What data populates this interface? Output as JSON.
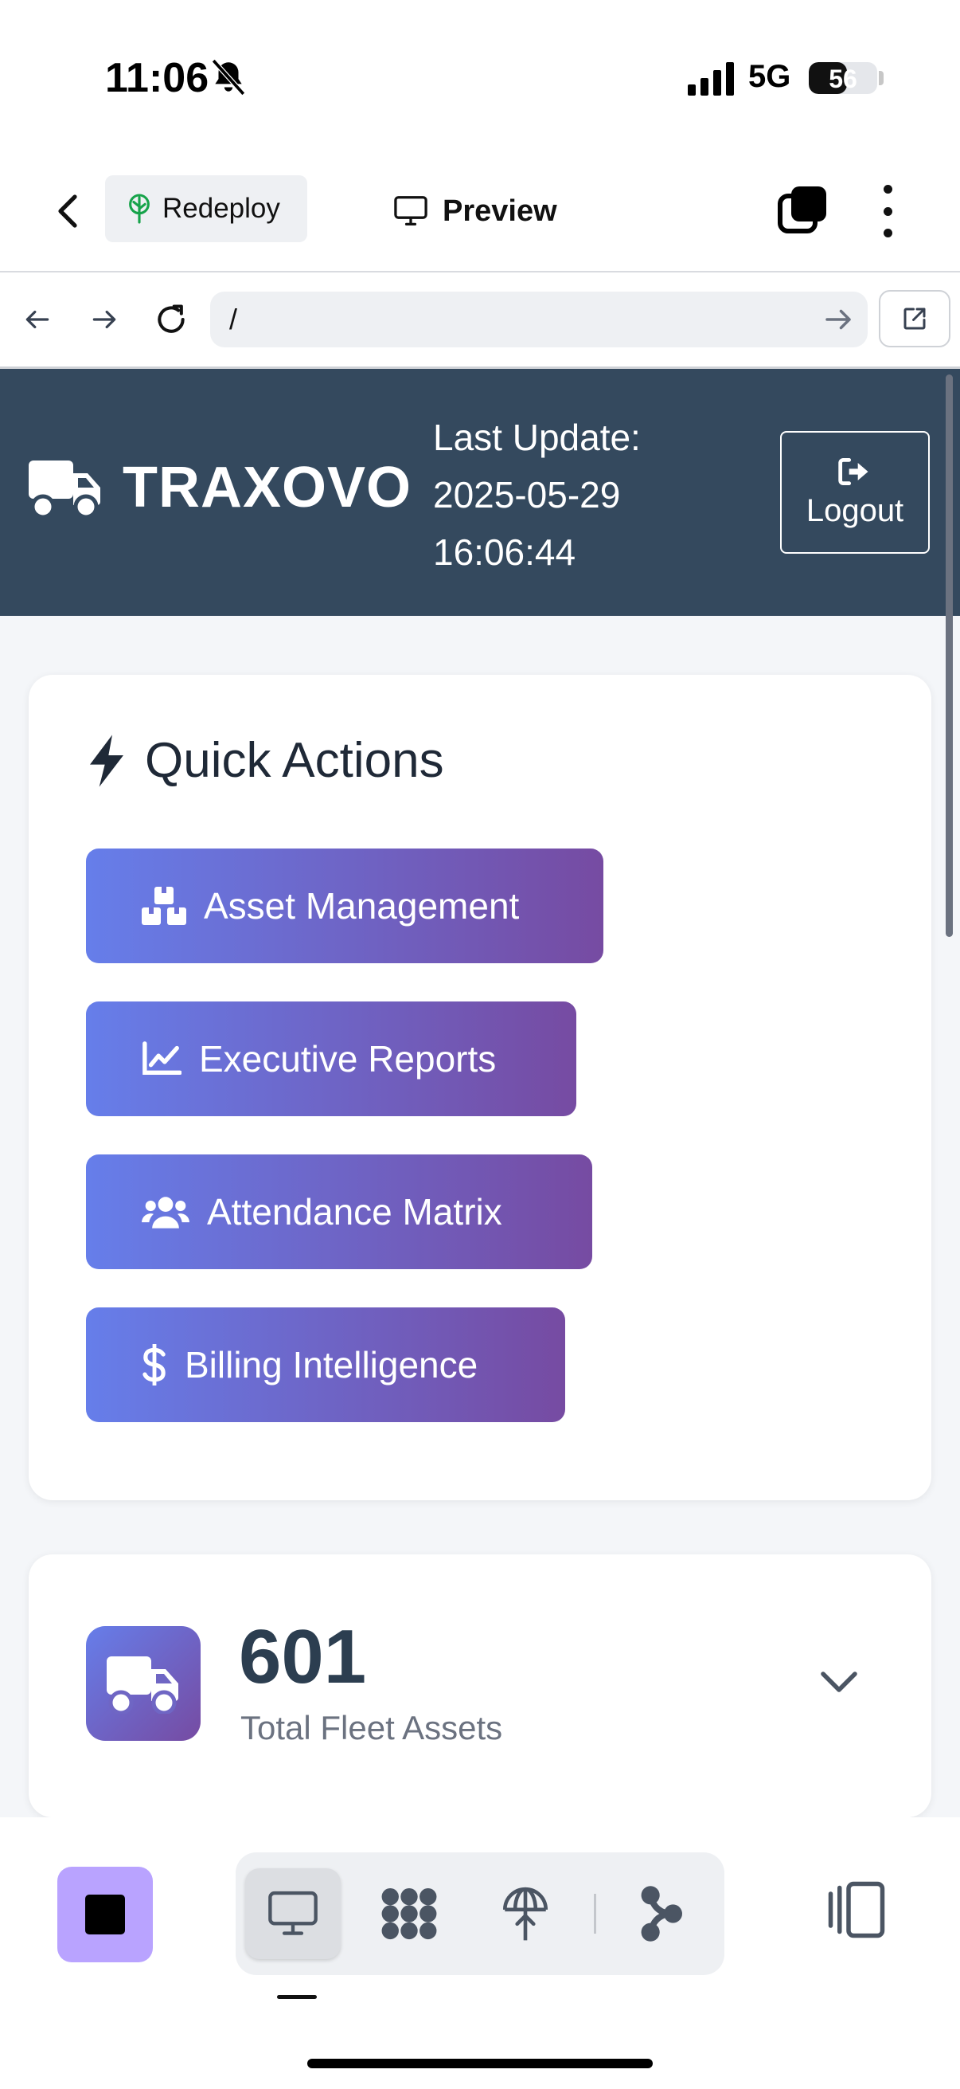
{
  "status_bar": {
    "time": "11:06",
    "network": "5G",
    "battery": "56",
    "battery_level": 0.56
  },
  "toolbar": {
    "redeploy_label": "Redeploy",
    "preview_label": "Preview"
  },
  "url_bar": {
    "value": "/"
  },
  "header": {
    "brand": "TRAXOVO",
    "last_update_label": "Last Update:",
    "last_update_date": "2025-05-29",
    "last_update_time": "16:06:44",
    "logout_label": "Logout",
    "background": "#34495e"
  },
  "quick_actions": {
    "title": "Quick Actions",
    "items": [
      {
        "label": "Asset Management",
        "icon": "boxes-icon"
      },
      {
        "label": "Executive Reports",
        "icon": "chart-line-icon"
      },
      {
        "label": "Attendance Matrix",
        "icon": "users-icon"
      },
      {
        "label": "Billing Intelligence",
        "icon": "dollar-icon"
      }
    ],
    "gradient": [
      "#667eea",
      "#764ba2"
    ]
  },
  "stat_card": {
    "value": "601",
    "label": "Total Fleet Assets",
    "icon": "truck-icon"
  },
  "bottom_bar": {
    "accent": "#b9a3ff"
  }
}
